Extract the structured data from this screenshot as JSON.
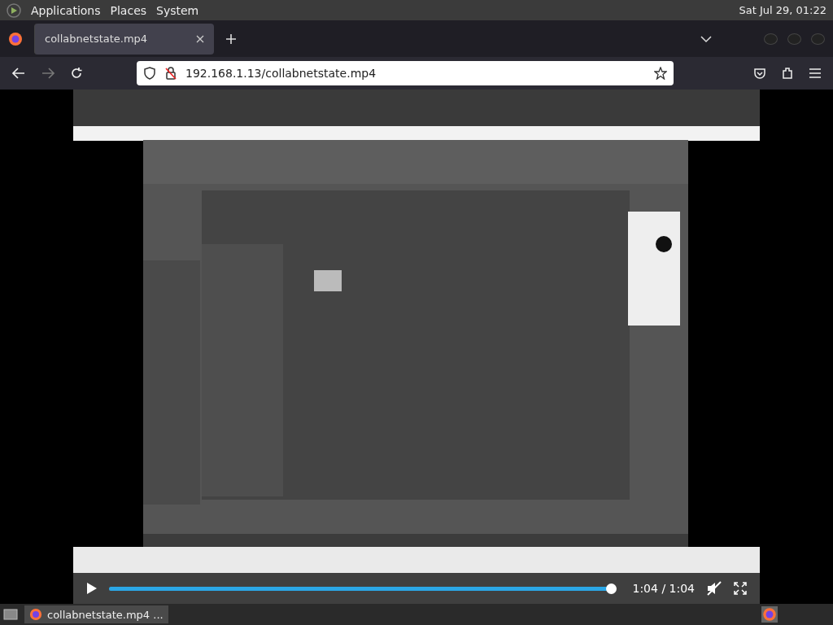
{
  "top_panel": {
    "menus": [
      "Applications",
      "Places",
      "System"
    ],
    "clock": "Sat Jul 29, 01:22"
  },
  "tabs": [
    {
      "title": "collabnetstate.mp4",
      "selected": true
    }
  ],
  "address_bar": {
    "url": "192.168.1.13/collabnetstate.mp4"
  },
  "video": {
    "kind": "picture",
    "progress": {
      "level": 1.0
    },
    "time": "1:04 / 1:04",
    "muted": true
  },
  "taskbar": {
    "windows": [
      {
        "title": "collabnetstate.mp4 ...",
        "selected": true
      }
    ]
  }
}
